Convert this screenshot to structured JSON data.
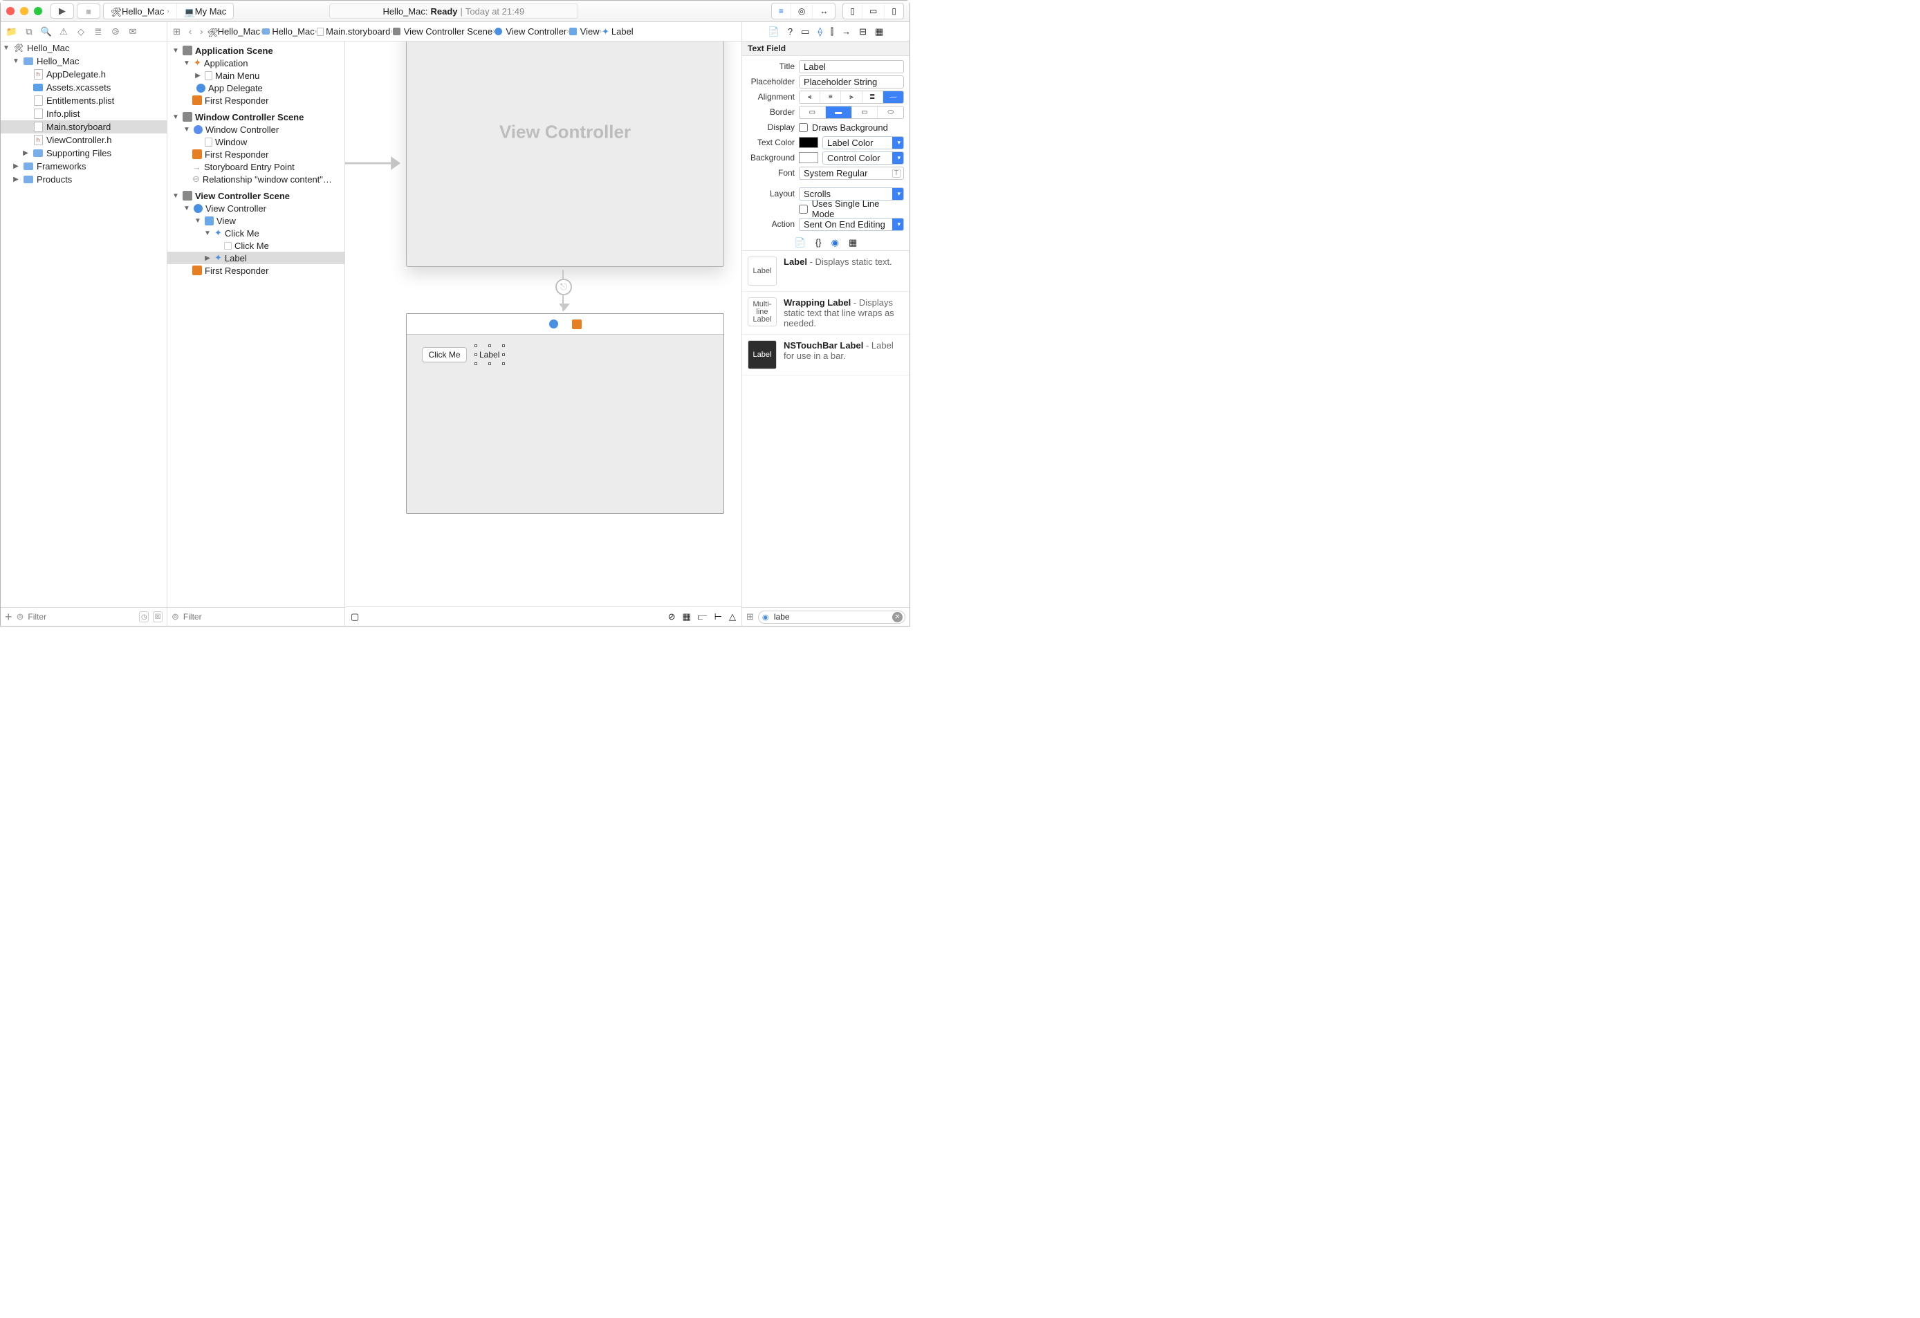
{
  "titlebar": {
    "scheme": "Hello_Mac",
    "device": "My Mac",
    "status_left": "Hello_Mac:",
    "status_bold": "Ready",
    "status_sep": "|",
    "status_right": "Today at 21:49"
  },
  "navigator": {
    "filter_placeholder": "Filter",
    "tree": {
      "project": "Hello_Mac",
      "target": "Hello_Mac",
      "files": [
        "AppDelegate.h",
        "Assets.xcassets",
        "Entitlements.plist",
        "Info.plist",
        "Main.storyboard",
        "ViewController.h"
      ],
      "supporting": "Supporting Files",
      "frameworks": "Frameworks",
      "products": "Products"
    }
  },
  "jumpbar": {
    "grid": "⊞",
    "back": "‹",
    "fwd": "›",
    "crumbs": [
      "Hello_Mac",
      "Hello_Mac",
      "Main.storyboard",
      "View Controller Scene",
      "View Controller",
      "View",
      "Label"
    ]
  },
  "outline": {
    "app_scene": "Application Scene",
    "application": "Application",
    "main_menu": "Main Menu",
    "app_delegate": "App Delegate",
    "first_responder": "First Responder",
    "win_scene": "Window Controller Scene",
    "win_controller": "Window Controller",
    "window": "Window",
    "entry": "Storyboard Entry Point",
    "rel": "Relationship \"window content\" to \"...",
    "vc_scene": "View Controller Scene",
    "view_controller": "View Controller",
    "view": "View",
    "click_me": "Click Me",
    "click_me_inner": "Click Me",
    "label": "Label",
    "filter_placeholder": "Filter"
  },
  "canvas": {
    "vc_placeholder": "View Controller",
    "button_label": "Click Me",
    "label_text": "Label"
  },
  "inspector": {
    "header": "Text Field",
    "title_label": "Title",
    "title_value": "Label",
    "placeholder_label": "Placeholder",
    "placeholder_value": "Placeholder String",
    "alignment_label": "Alignment",
    "border_label": "Border",
    "display_label": "Display",
    "draws_bg": "Draws Background",
    "textcolor_label": "Text Color",
    "textcolor_value": "Label Color",
    "bgcolor_label": "Background",
    "bgcolor_value": "Control Color",
    "font_label": "Font",
    "font_value": "System Regular",
    "layout_label": "Layout",
    "layout_value": "Scrolls",
    "single_line": "Uses Single Line Mode",
    "action_label": "Action",
    "action_value": "Sent On End Editing"
  },
  "library": {
    "items": [
      {
        "iconText": "Label",
        "title": "Label",
        "desc": " - Displays static text."
      },
      {
        "iconText": "Multi-\nline\nLabel",
        "title": "Wrapping Label",
        "desc": " - Displays static text that line wraps as needed."
      },
      {
        "iconText": "Label",
        "title": "NSTouchBar Label",
        "desc": " - Label for use in a bar.",
        "dark": true
      }
    ],
    "filter_value": "labe"
  }
}
